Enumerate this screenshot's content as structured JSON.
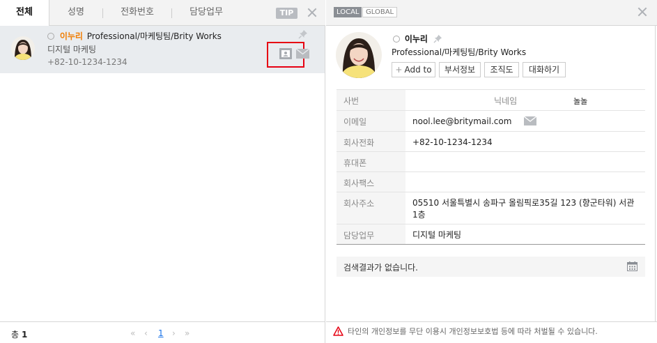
{
  "left_tabs": {
    "all": "전체",
    "name": "성명",
    "phone": "전화번호",
    "duty": "담당업무",
    "tip": "TIP"
  },
  "result": {
    "name": "이누리",
    "org": "Professional/마케팅팀/Brity Works",
    "dept": "디지털 마케팅",
    "phone": "+82-10-1234-1234"
  },
  "footer_left": {
    "total_label": "총",
    "total_count": "1",
    "first": "«",
    "prev": "‹",
    "page": "1",
    "next": "›",
    "last": "»"
  },
  "scope": {
    "local": "LOCAL",
    "global": "GLOBAL"
  },
  "profile": {
    "name": "이누리",
    "org": "Professional/마케팅팀/Brity Works",
    "buttons": {
      "add": "Add to",
      "dept_info": "부서정보",
      "org_chart": "조직도",
      "chat": "대화하기"
    }
  },
  "info": {
    "emp_no_label": "사번",
    "emp_no": "",
    "nickname_label": "닉네임",
    "nickname": "놀놀",
    "email_label": "이메일",
    "email": "nool.lee@britymail.com",
    "office_phone_label": "회사전화",
    "office_phone": "+82-10-1234-1234",
    "mobile_label": "휴대폰",
    "mobile": "",
    "fax_label": "회사팩스",
    "fax": "",
    "address_label": "회사주소",
    "address": "05510 서울특별시 송파구 올림픽로35길 123 (향군타워) 서관 1층",
    "duty_label": "담당업무",
    "duty": "디지털 마케팅"
  },
  "search_result": "검색결과가 없습니다.",
  "warning": "타인의 개인정보를 무단 이용시 개인정보보호법 등에 따라 처벌될 수 있습니다.",
  "colors": {
    "name_accent": "#f07c00",
    "highlight": "#e60012",
    "link": "#1a73e8",
    "warning": "#e60012"
  }
}
